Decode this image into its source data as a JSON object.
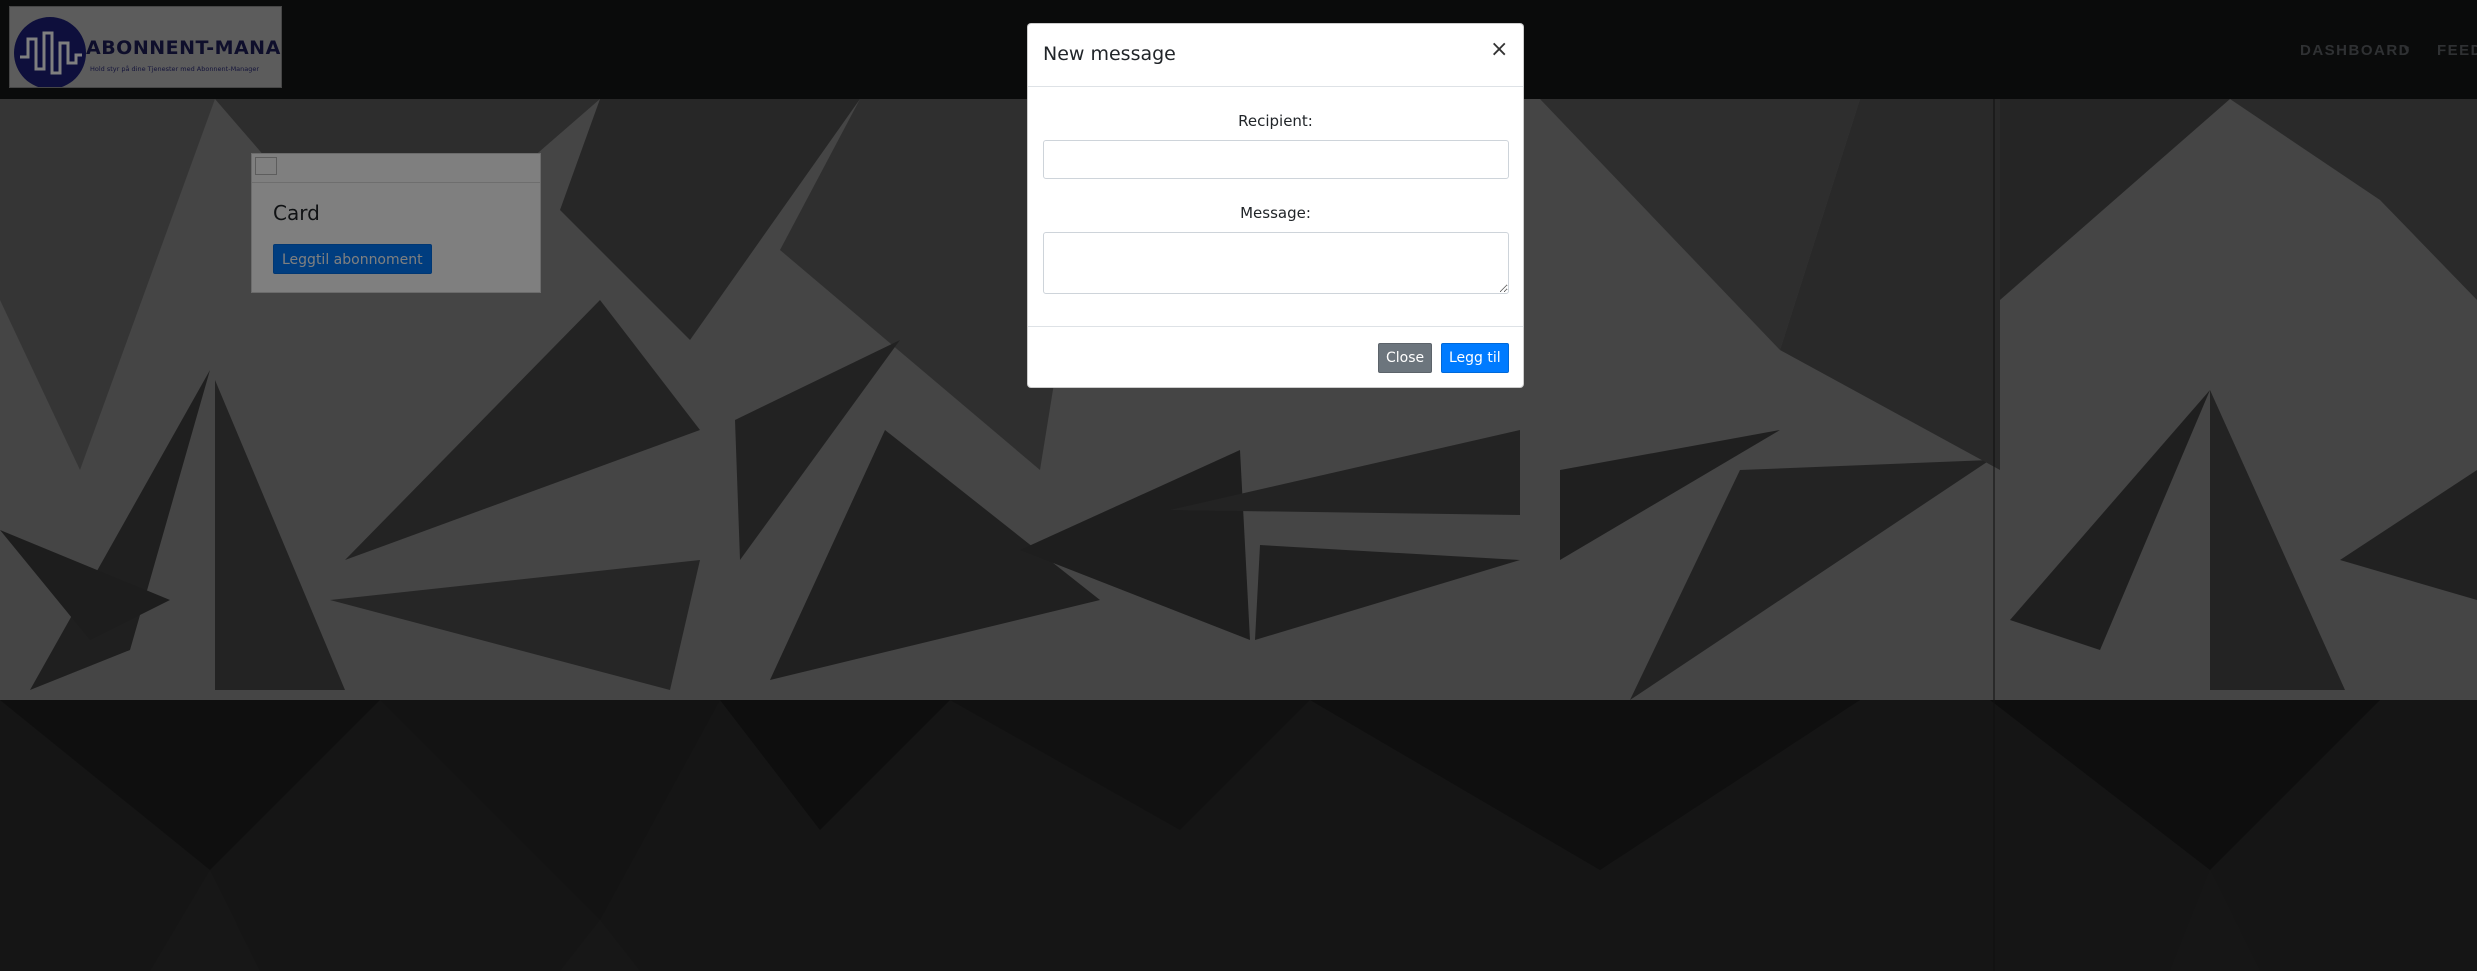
{
  "brand": {
    "title": "ABONNENT-MANAGER",
    "subtitle": "Hold styr på dine Tjenester med Abonnent-Manager"
  },
  "nav": {
    "dashboard_label": "DASHBOARD",
    "dashboard_caret": "▾",
    "feedback_label": "FEED"
  },
  "card": {
    "title": "Card",
    "button_label": "Leggtil abonnoment"
  },
  "modal": {
    "title": "New message",
    "close_symbol": "×",
    "recipient_label": "Recipient:",
    "recipient_value": "",
    "message_label": "Message:",
    "message_value": "",
    "close_button": "Close",
    "add_button": "Legg til"
  },
  "colors": {
    "navbar_bg": "#151617",
    "primary": "#007bff",
    "secondary": "#6c757d",
    "logo_circle": "#1c1f78"
  }
}
